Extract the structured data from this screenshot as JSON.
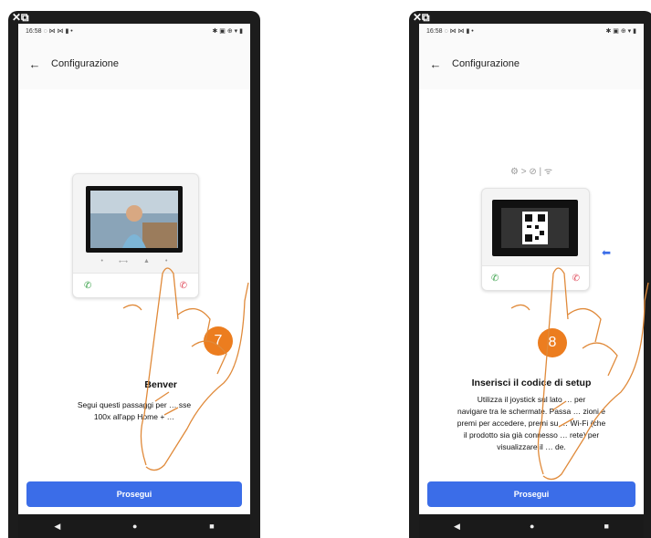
{
  "phone_left": {
    "status_time": "16:58",
    "status_icons_left": "◌ ⋈ ⋈ ▮ •",
    "status_icons_right": "✱ ▣ ⊕ ▾ ▮",
    "app_title": "Configurazione",
    "heading": "Benvenuto",
    "heading_visible": "Benver",
    "description_line1": "Segui questi passaggi per … sse",
    "description_line2": "100x all'app Home + …",
    "button_label": "Prosegui",
    "step_number": "7"
  },
  "phone_right": {
    "status_time": "16:58",
    "status_icons_left": "◌ ⋈ ⋈ ▮ •",
    "status_icons_right": "✱ ▣ ⊕ ▾ ▮",
    "app_title": "Configurazione",
    "heading": "Inserisci il codice di setup",
    "description_lines": [
      "Utilizza il joystick sul lato … per",
      "navigare tra le schermate. Passa … zioni e",
      "premi per accedere, premi su … Wi-Fi (che",
      "il prodotto sia già connesso … rete) per",
      "visualizzare il … de."
    ],
    "button_label": "Prosegui",
    "step_number": "8",
    "breadcrumb_icons": "⚙ > ⊘ | ᯤ"
  },
  "colors": {
    "accent_blue": "#3b6de8",
    "badge_orange": "#ec7d1f",
    "phone_frame": "#1c1c1c"
  }
}
